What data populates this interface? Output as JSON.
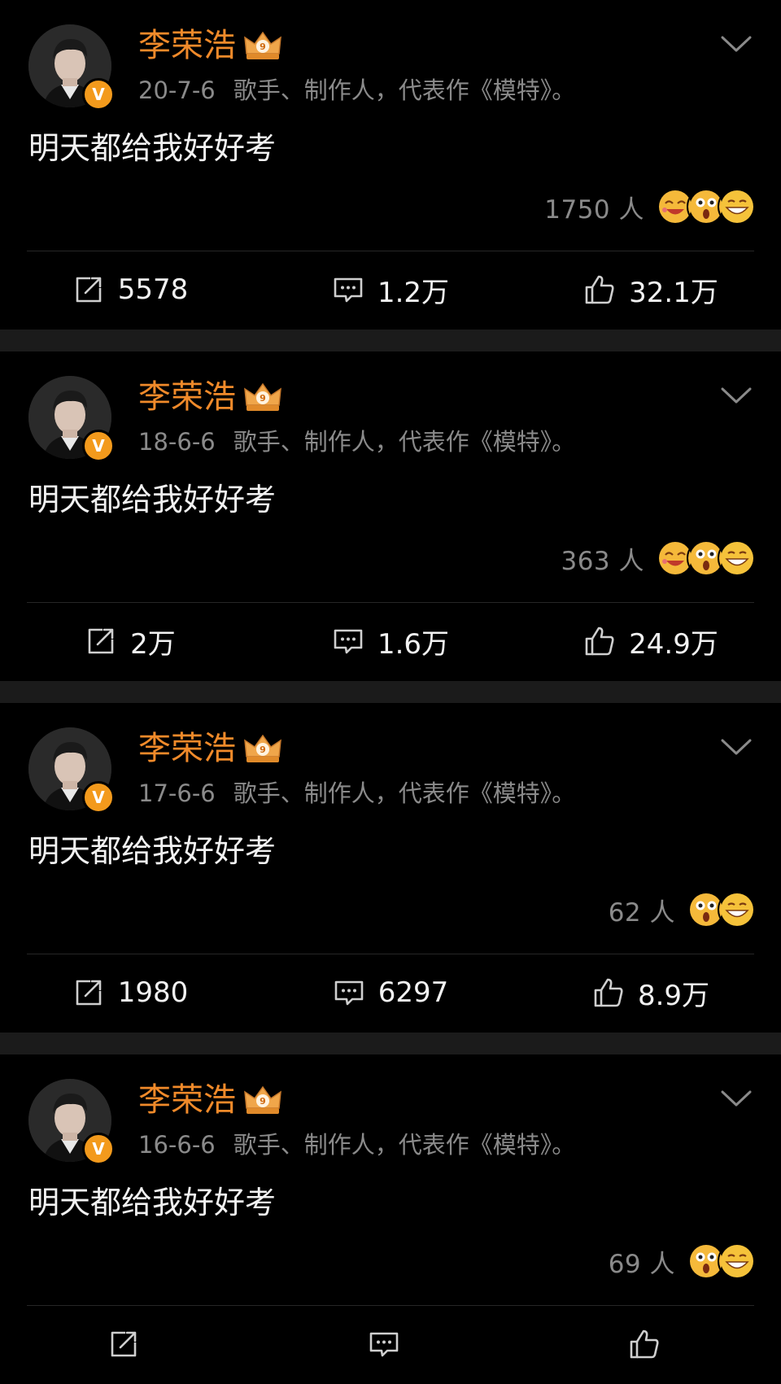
{
  "theme": {
    "background": "#000000",
    "separator": "#1b1b1b",
    "name_color": "#f08a2a",
    "badge_color": "#f39a1c",
    "meta_color": "#8a8a8a"
  },
  "posts": [
    {
      "author": "李荣浩",
      "date": "20-7-6",
      "bio": "歌手、制作人，代表作《模特》。",
      "text": "明天都给我好好考",
      "reactions_count": "1750 人",
      "reaction_emojis": [
        "laugh-cry-icon",
        "shocked-icon",
        "grin-icon"
      ],
      "reposts": "5578",
      "comments": "1.2万",
      "likes": "32.1万"
    },
    {
      "author": "李荣浩",
      "date": "18-6-6",
      "bio": "歌手、制作人，代表作《模特》。",
      "text": "明天都给我好好考",
      "reactions_count": "363 人",
      "reaction_emojis": [
        "laugh-cry-icon",
        "shocked-icon",
        "grin-icon"
      ],
      "reposts": "2万",
      "comments": "1.6万",
      "likes": "24.9万"
    },
    {
      "author": "李荣浩",
      "date": "17-6-6",
      "bio": "歌手、制作人，代表作《模特》。",
      "text": "明天都给我好好考",
      "reactions_count": "62 人",
      "reaction_emojis": [
        "shocked-icon",
        "grin-icon"
      ],
      "reposts": "1980",
      "comments": "6297",
      "likes": "8.9万"
    },
    {
      "author": "李荣浩",
      "date": "16-6-6",
      "bio": "歌手、制作人，代表作《模特》。",
      "text": "明天都给我好好考",
      "reactions_count": "69 人",
      "reaction_emojis": [
        "shocked-icon",
        "grin-icon"
      ],
      "reposts": "",
      "comments": "",
      "likes": ""
    }
  ],
  "icons": {
    "verified": "v-badge-icon",
    "vip": "crown-badge-icon",
    "menu": "chevron-down-icon",
    "repost": "repost-icon",
    "comment": "comment-icon",
    "like": "thumbs-up-icon"
  },
  "badge_letter": "V",
  "vip_level": "9"
}
